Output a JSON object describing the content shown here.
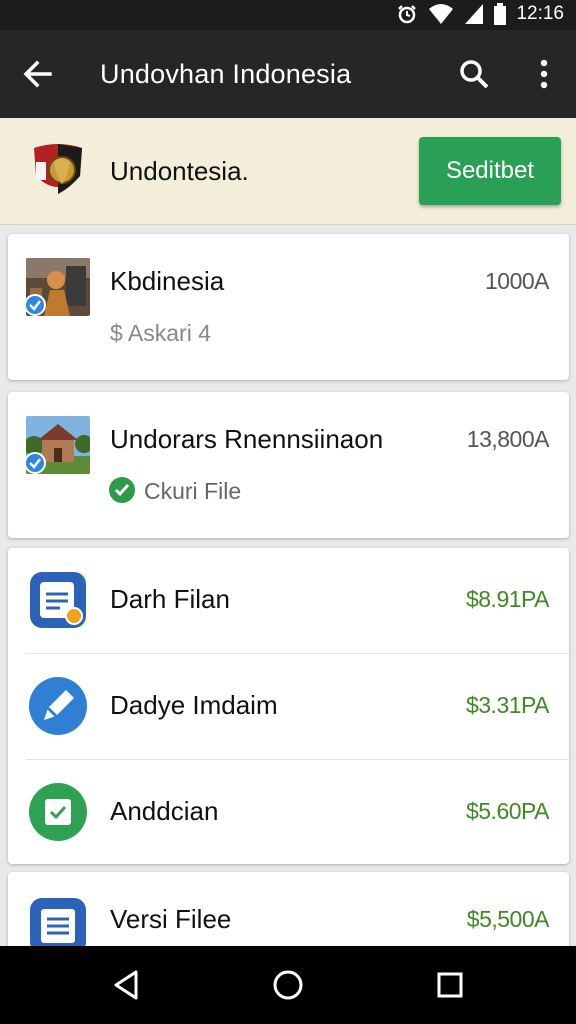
{
  "status": {
    "time": "12:16"
  },
  "appbar": {
    "title": "Undovhan Indonesia",
    "back_icon": "arrow-left-icon",
    "search_icon": "search-icon",
    "more_icon": "more-vert-icon"
  },
  "banner": {
    "title": "Undontesia.",
    "button_label": "Seditbet"
  },
  "cards": [
    {
      "name": "Kbdinesia",
      "amount": "1000A",
      "sub": "$ Askari 4"
    },
    {
      "name": "Undorars Rnennsiinaon",
      "amount": "13,800A",
      "sub": "Ckuri File"
    }
  ],
  "list": [
    {
      "name": "Darh Filan",
      "amount": "$8.91PA",
      "icon": "document-icon"
    },
    {
      "name": "Dadye Imdaim",
      "amount": "$3.31PA",
      "icon": "edit-icon"
    },
    {
      "name": "Anddcian",
      "amount": "$5.60PA",
      "icon": "task-check-icon"
    },
    {
      "name": "Versi Filee",
      "amount": "$5,500A",
      "icon": "list-icon"
    }
  ],
  "colors": {
    "accent": "#29a055",
    "amount_green": "#3f8a22",
    "appbar": "#262626",
    "banner": "#f3eed9"
  }
}
